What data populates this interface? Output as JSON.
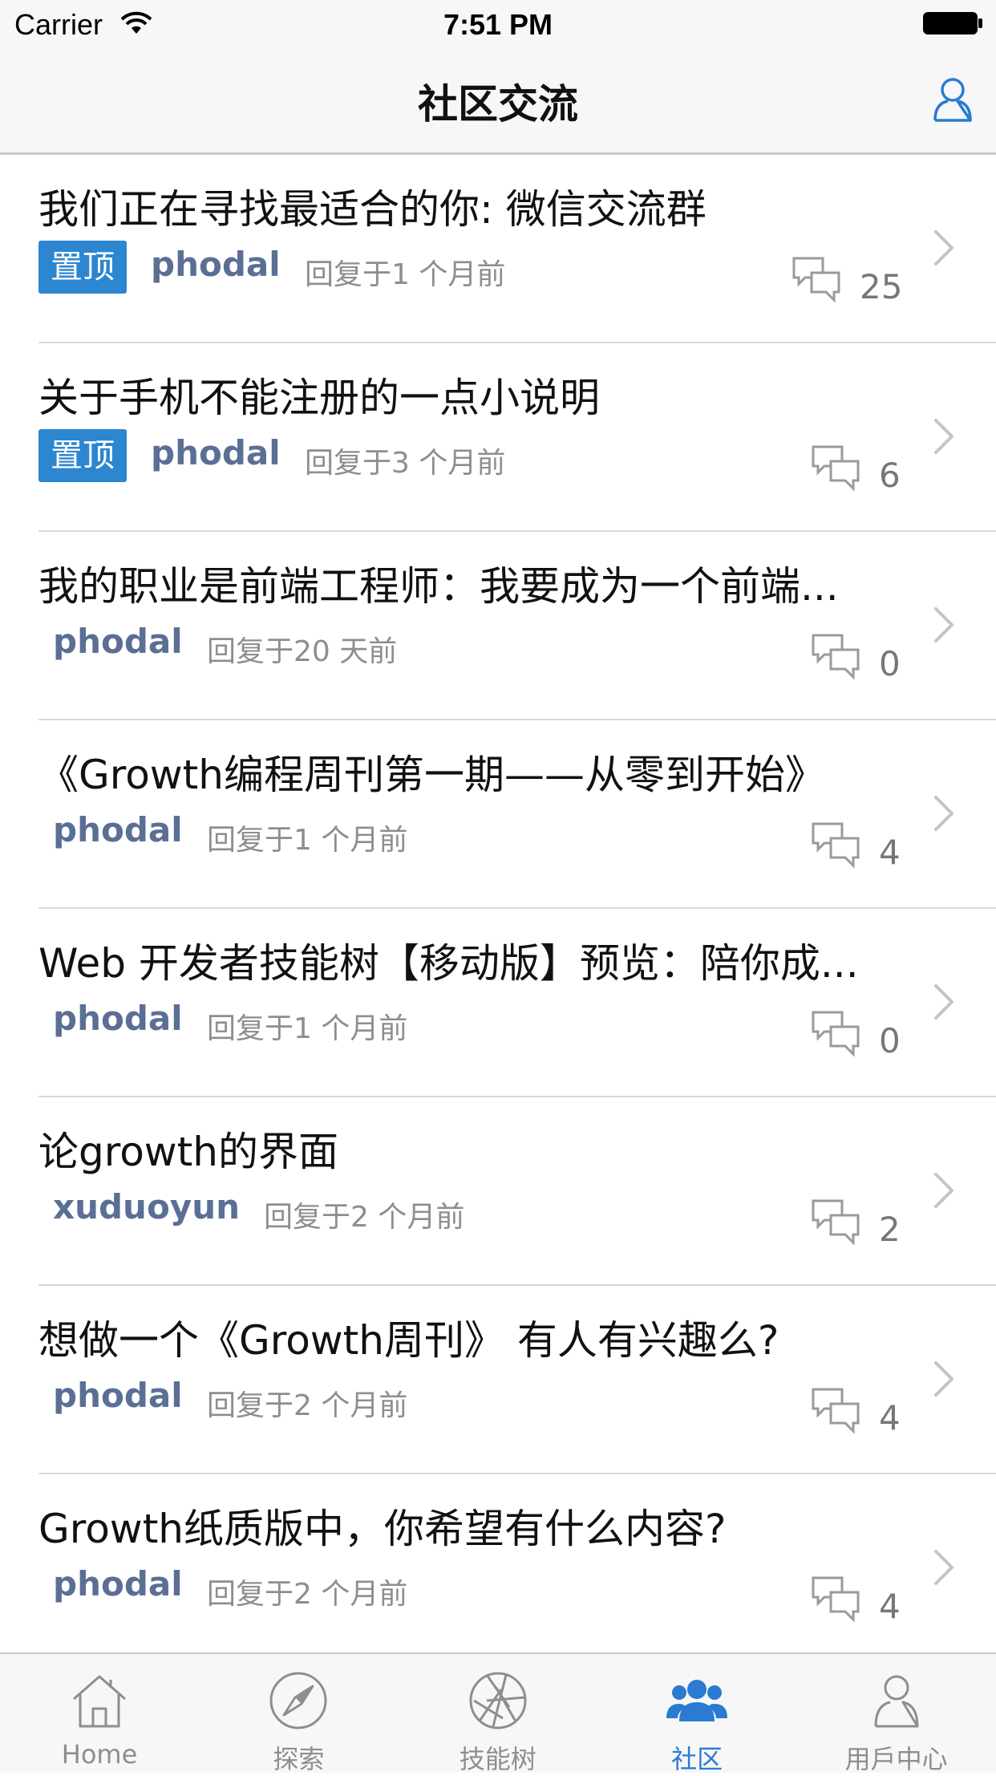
{
  "status_bar": {
    "carrier": "Carrier",
    "time": "7:51 PM"
  },
  "nav": {
    "title": "社区交流"
  },
  "topics": [
    {
      "title": "我们正在寻找最适合的你: 微信交流群",
      "pinned": true,
      "badge": "置顶",
      "author": "phodal",
      "time": "回复于1 个月前",
      "count": "25"
    },
    {
      "title": "关于手机不能注册的一点小说明",
      "pinned": true,
      "badge": "置顶",
      "author": "phodal",
      "time": "回复于3 个月前",
      "count": "6"
    },
    {
      "title": "我的职业是前端工程师：我要成为一个前端...",
      "pinned": false,
      "author": "phodal",
      "time": "回复于20 天前",
      "count": "0"
    },
    {
      "title": "《Growth编程周刊第一期——从零到开始》",
      "pinned": false,
      "author": "phodal",
      "time": "回复于1 个月前",
      "count": "4"
    },
    {
      "title": "Web 开发者技能树【移动版】预览：陪你成...",
      "pinned": false,
      "author": "phodal",
      "time": "回复于1 个月前",
      "count": "0"
    },
    {
      "title": "论growth的界面",
      "pinned": false,
      "author": "xuduoyun",
      "time": "回复于2 个月前",
      "count": "2"
    },
    {
      "title": "想做一个《Growth周刊》 有人有兴趣么?",
      "pinned": false,
      "author": "phodal",
      "time": "回复于2 个月前",
      "count": "4"
    },
    {
      "title": "Growth纸质版中，你希望有什么内容?",
      "pinned": false,
      "author": "phodal",
      "time": "回复于2 个月前",
      "count": "4"
    }
  ],
  "tabs": [
    {
      "label": "Home",
      "icon": "home-icon",
      "active": false
    },
    {
      "label": "探索",
      "icon": "compass-icon",
      "active": false
    },
    {
      "label": "技能树",
      "icon": "aperture-icon",
      "active": false
    },
    {
      "label": "社区",
      "icon": "community-icon",
      "active": true
    },
    {
      "label": "用戶中心",
      "icon": "user-icon",
      "active": false
    }
  ],
  "colors": {
    "accent": "#2a7bd1",
    "badge": "#2c86d0",
    "author": "#5b6f95",
    "meta": "#8e8e8e"
  }
}
